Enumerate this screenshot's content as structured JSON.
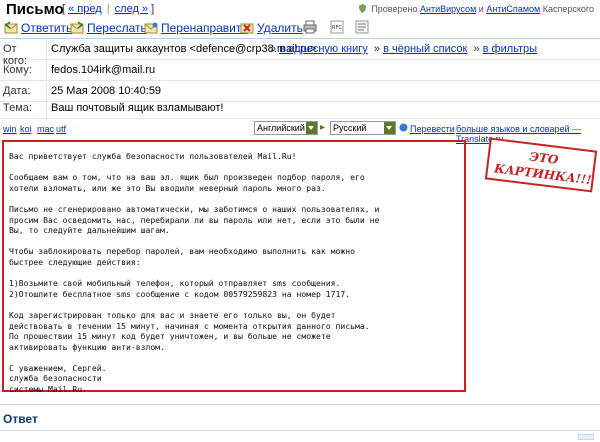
{
  "title": "Письмо",
  "nav": {
    "prev": "« пред",
    "separator": "|",
    "next": "след »"
  },
  "verified": {
    "prefix": "Проверено",
    "antivirus": "АнтиВирусом",
    "and": "и",
    "antispam": "АнтиСпамом",
    "suffix": "Касперского"
  },
  "toolbar": {
    "reply": "Ответить",
    "forward": "Переслать",
    "redirect": "Перенаправить",
    "delete": "Удалить",
    "rfc": "RFC"
  },
  "headers": [
    {
      "label": "От кого:",
      "value": "Служба защиты аккаунтов <defence@crp38.mail.ru>"
    },
    {
      "label": "Кому:",
      "value": "fedos.104irk@mail.ru"
    },
    {
      "label": "Дата:",
      "value": "25 Мая 2008 10:40:59"
    },
    {
      "label": "Тема:",
      "value": "Ваш почтовый ящик взламывают!"
    }
  ],
  "sender_actions": {
    "address_book": "в адресную книгу",
    "blacklist": "в чёрный список",
    "filters": "в фильтры"
  },
  "encodings": [
    "win",
    "koi",
    "mac",
    "utf"
  ],
  "translate": {
    "from": "Английский",
    "to": "Русский",
    "button": "Перевести",
    "more": "больше языков и словарей — Translate.ru"
  },
  "message_body": "Вас приветствует служба безопасности пользователей Mail.Ru!\n\nСообщаем вам о том, что на ваш эл. ящик был произведен подбор пароля, его\nхотели взломать, или же это Вы вводили неверный пароль много раз.\n\nПисьмо не сгенерировано автоматически, мы заботимся о наших пользователях, и\nпросим Вас осведомить нас, перебирали ли вы пароль или нет, если это были не\nВы, то следуйте дальнейшим шагам.\n\nЧтобы заблокировать перебор паролей, вам необходимо выполнить как можно\nбыстрее следующие действия:\n\n1)Возьмите свой мобильный телефон, который отправляет sms сообщения.\n2)Отошлите бесплатное sms сообщение с кодом 00579259823 на номер 1717.\n\nКод зарегистрирован только для вас и знаете его только вы, он будет\nдействовать в течении 15 минут, начиная с момента открытия данного письма.\nПо прошествии 15 минут код будет уничтожен, и вы больше не сможете\nактивировать функцию анти-взлом.\n\nС уважением, Сергей.\nслужба безопасности\nсистемы Mail.Ru.",
  "annotation": "ЭТО КАРТИНКА!!!",
  "reply_section": "Ответ",
  "colors": {
    "highlight": "#cc1f1f",
    "link": "#0033cc",
    "heading": "#0d3a7a"
  }
}
